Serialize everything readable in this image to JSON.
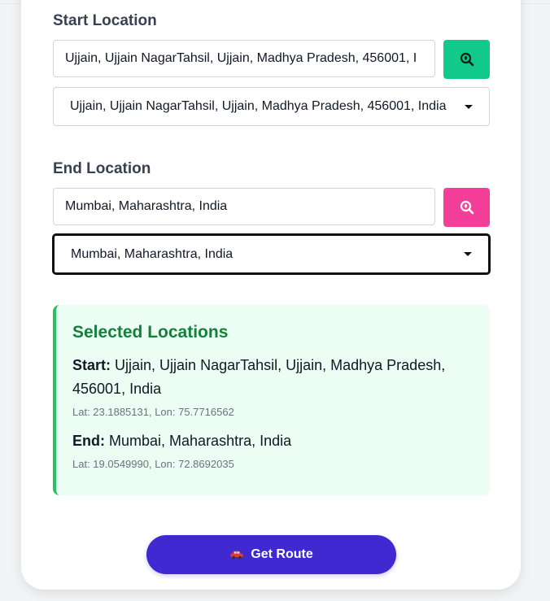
{
  "start": {
    "label": "Start Location",
    "input_value": "Ujjain, Ujjain NagarTahsil, Ujjain, Madhya Pradesh, 456001, I",
    "selected_option": "Ujjain, Ujjain NagarTahsil, Ujjain, Madhya Pradesh, 456001, India",
    "search_icon": "search-location-icon",
    "button_color": "#10c98a"
  },
  "end": {
    "label": "End Location",
    "input_value": "Mumbai, Maharashtra, India",
    "selected_option": "Mumbai, Maharashtra, India",
    "search_icon": "search-location-icon",
    "button_color": "#f43f9a"
  },
  "summary": {
    "title": "Selected Locations",
    "start_label": "Start:",
    "start_value": "Ujjain, Ujjain NagarTahsil, Ujjain, Madhya Pradesh, 456001, India",
    "start_coords": "Lat: 23.1885131, Lon: 75.7716562",
    "end_label": "End:",
    "end_value": "Mumbai, Maharashtra, India",
    "end_coords": "Lat: 19.0549990, Lon: 72.8692035"
  },
  "route_button": {
    "icon": "car-icon",
    "label": "Get Route",
    "color": "#4129d2"
  }
}
